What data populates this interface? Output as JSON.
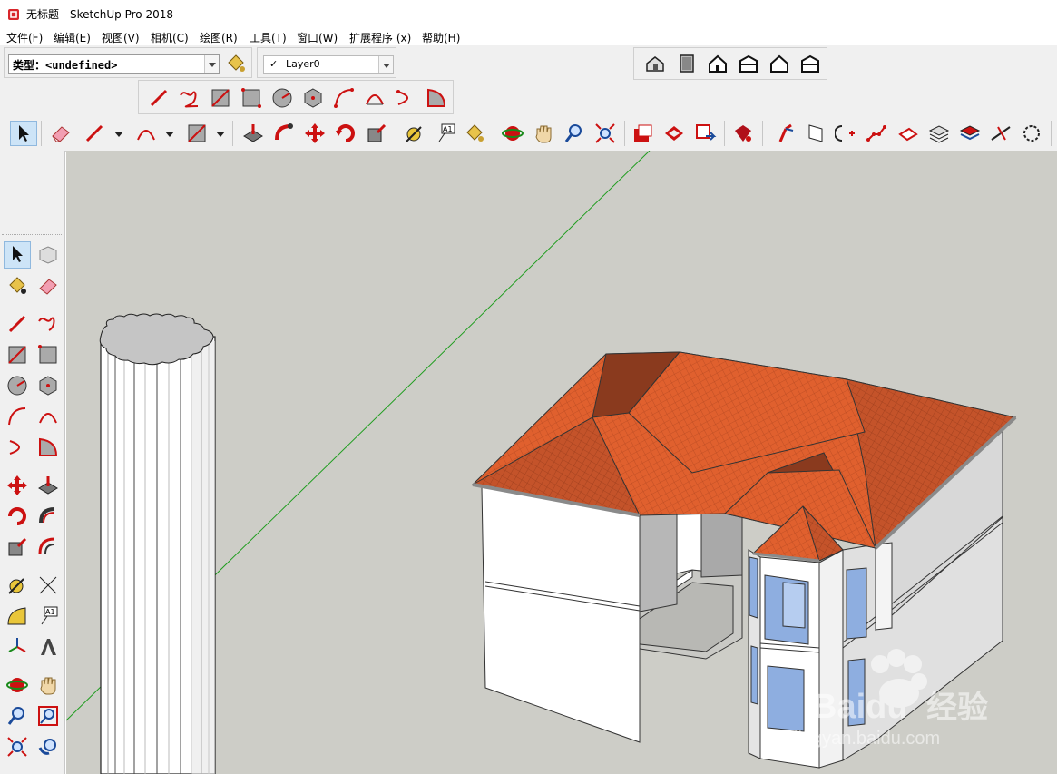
{
  "window": {
    "title": "无标题 - SketchUp Pro 2018"
  },
  "menu": {
    "items": [
      "文件(F)",
      "编辑(E)",
      "视图(V)",
      "相机(C)",
      "绘图(R)",
      "工具(T)",
      "窗口(W)",
      "扩展程序 (x)",
      "帮助(H)"
    ]
  },
  "entity_info": {
    "type_text": "类型：<undefined>"
  },
  "layers": {
    "check": "✓",
    "current": "Layer0"
  },
  "watermark": {
    "brand": "Baidu",
    "brand_cn": "经验",
    "url": "jingyan.baidu.com"
  },
  "colors": {
    "viewport_bg": "#cdcdc7",
    "roof": "#e0602e",
    "roof_dark": "#8a3a1e",
    "wall": "#ffffff",
    "glass": "#8eaee0",
    "axis_green": "#1f9d1f"
  }
}
